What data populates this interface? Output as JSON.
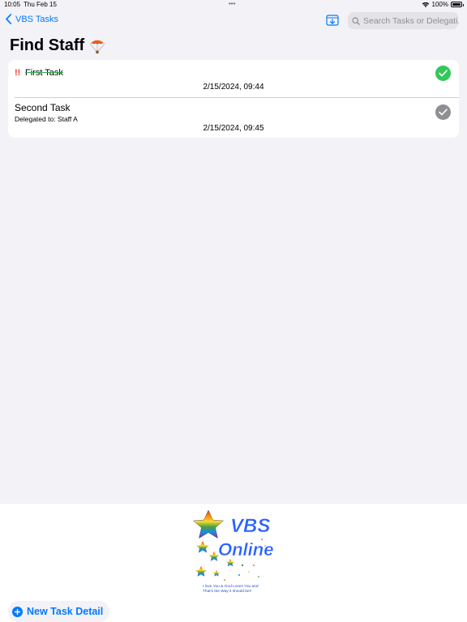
{
  "status_bar": {
    "time": "10:05",
    "date": "Thu Feb 15",
    "dots": "•••",
    "battery": "100%",
    "battery_level": 1.0
  },
  "nav": {
    "back_label": "VBS Tasks",
    "search_placeholder": "Search Tasks or Delegati...",
    "archive_icon": "tray-arrow-down-icon"
  },
  "page": {
    "title": "Find Staff",
    "title_icon": "parachute-icon"
  },
  "tasks": [
    {
      "priority": "!!",
      "name": "First Task",
      "delegated": "",
      "date": "2/15/2024, 09:44",
      "completed": true
    },
    {
      "priority": "",
      "name": "Second Task",
      "delegated": "Delegated to: Staff A",
      "date": "2/15/2024, 09:45",
      "completed": false
    }
  ],
  "logo": {
    "line1": "VBS",
    "line2": "Online",
    "tagline": "I love You & God Loves You and That's the Way it should be!!"
  },
  "bottom": {
    "new_task_label": "New Task Detail"
  },
  "colors": {
    "accent": "#007aff",
    "done": "#34c759",
    "pending": "#8e8e93",
    "priority": "#ff3b30"
  }
}
